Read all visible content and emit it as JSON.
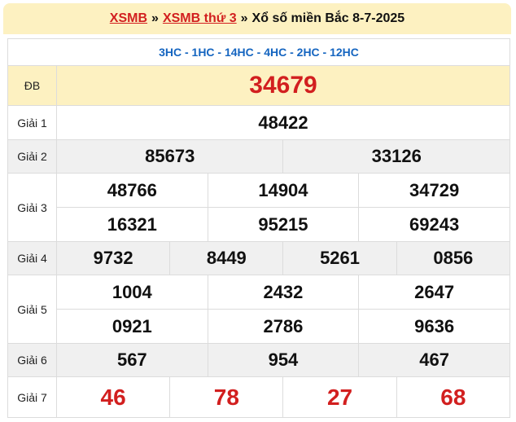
{
  "header": {
    "link1": "XSMB",
    "sep1": "»",
    "link2": "XSMB thứ 3",
    "sep2": "»",
    "title": "Xổ số miền Bắc 8-7-2025"
  },
  "codes": "3HC - 1HC - 14HC - 4HC - 2HC - 12HC",
  "db": {
    "label": "ĐB",
    "value": "34679"
  },
  "g1": {
    "label": "Giải 1",
    "values": [
      "48422"
    ]
  },
  "g2": {
    "label": "Giải 2",
    "values": [
      "85673",
      "33126"
    ]
  },
  "g3": {
    "label": "Giải 3",
    "values": [
      "48766",
      "14904",
      "34729",
      "16321",
      "95215",
      "69243"
    ]
  },
  "g4": {
    "label": "Giải 4",
    "values": [
      "9732",
      "8449",
      "5261",
      "0856"
    ]
  },
  "g5": {
    "label": "Giải 5",
    "values": [
      "1004",
      "2432",
      "2647",
      "0921",
      "2786",
      "9636"
    ]
  },
  "g6": {
    "label": "Giải 6",
    "values": [
      "567",
      "954",
      "467"
    ]
  },
  "g7": {
    "label": "Giải 7",
    "values": [
      "46",
      "78",
      "27",
      "68"
    ]
  },
  "colors": {
    "red": "#d21f1f",
    "blue": "#1565c0",
    "header_bg": "#fdf1c1",
    "row_gray": "#f0f0f0"
  }
}
